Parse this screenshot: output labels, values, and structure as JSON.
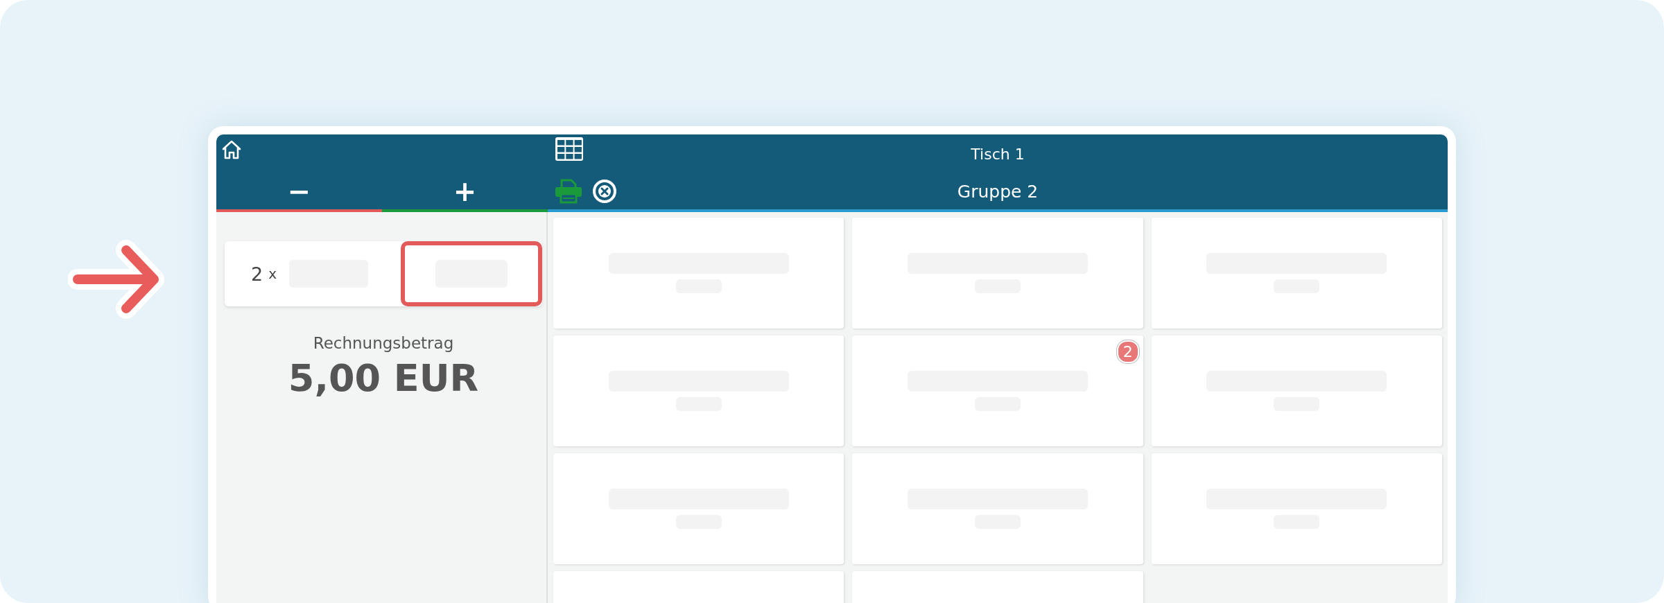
{
  "header": {
    "title": "Tisch 1",
    "group": "Gruppe 2"
  },
  "tabs": [
    {
      "label": "−",
      "color": "#e35a5a"
    },
    {
      "label": "+",
      "color": "#1a9a3a"
    }
  ],
  "order_items": [
    {
      "quantity": "2",
      "unit": "x",
      "highlighted": true
    }
  ],
  "total": {
    "label": "Rechnungsbetrag",
    "amount": "5,00 EUR"
  },
  "tiles": [
    {
      "kind": "placeholder"
    },
    {
      "kind": "placeholder"
    },
    {
      "kind": "placeholder"
    },
    {
      "kind": "placeholder"
    },
    {
      "kind": "placeholder",
      "badge": "2"
    },
    {
      "kind": "placeholder"
    },
    {
      "kind": "placeholder"
    },
    {
      "kind": "placeholder"
    },
    {
      "kind": "placeholder"
    },
    {
      "kind": "blank"
    },
    {
      "kind": "blank"
    }
  ]
}
